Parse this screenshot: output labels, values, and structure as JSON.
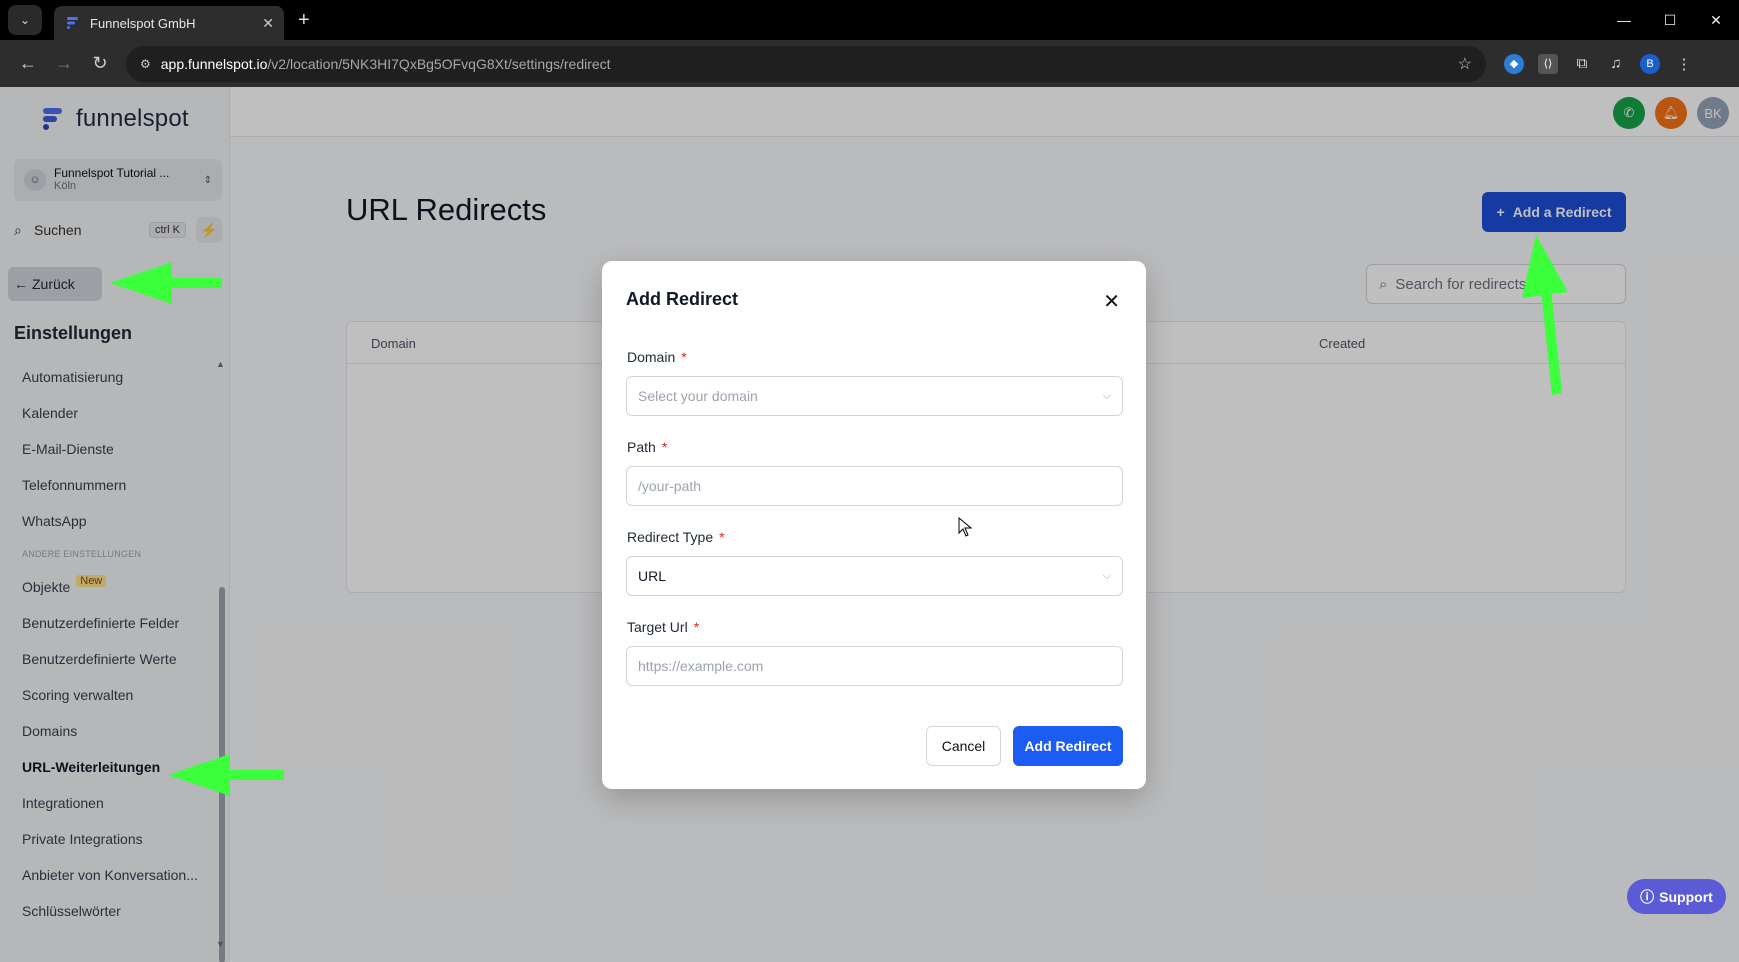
{
  "browser": {
    "tab_title": "Funnelspot GmbH",
    "url_host": "app.funnelspot.io",
    "url_path": "/v2/location/5NK3HI7QxBg5OFvqG8Xt/settings/redirect",
    "profile_initial": "B"
  },
  "sidebar": {
    "logo": "funnelspot",
    "account_name": "Funnelspot Tutorial ...",
    "account_location": "Köln",
    "search_label": "Suchen",
    "search_shortcut": "ctrl K",
    "back_label": "Zurück",
    "section_title": "Einstellungen",
    "items_top": [
      "Automatisierung",
      "Kalender",
      "E-Mail-Dienste",
      "Telefonnummern",
      "WhatsApp"
    ],
    "other_settings_header": "ANDERE EINSTELLUNGEN",
    "items_bottom": [
      "Objekte",
      "Benutzerdefinierte Felder",
      "Benutzerdefinierte Werte",
      "Scoring verwalten",
      "Domains",
      "URL-Weiterleitungen",
      "Integrationen",
      "Private Integrations",
      "Anbieter von Konversation...",
      "Schlüsselwörter"
    ],
    "new_badge": "New"
  },
  "header": {
    "avatar_initials": "BK"
  },
  "main": {
    "title": "URL Redirects",
    "add_button": "Add a Redirect",
    "search_placeholder": "Search for redirects",
    "columns": [
      "Domain",
      "Created"
    ]
  },
  "modal": {
    "title": "Add Redirect",
    "domain_label": "Domain",
    "domain_placeholder": "Select your domain",
    "path_label": "Path",
    "path_placeholder": "/your-path",
    "redirect_type_label": "Redirect Type",
    "redirect_type_value": "URL",
    "target_label": "Target Url",
    "target_placeholder": "https://example.com",
    "required_mark": "*",
    "cancel": "Cancel",
    "submit": "Add Redirect"
  },
  "support_label": "Support",
  "colors": {
    "primary": "#1d4ed8",
    "annotation_arrow": "#3cff3c"
  }
}
